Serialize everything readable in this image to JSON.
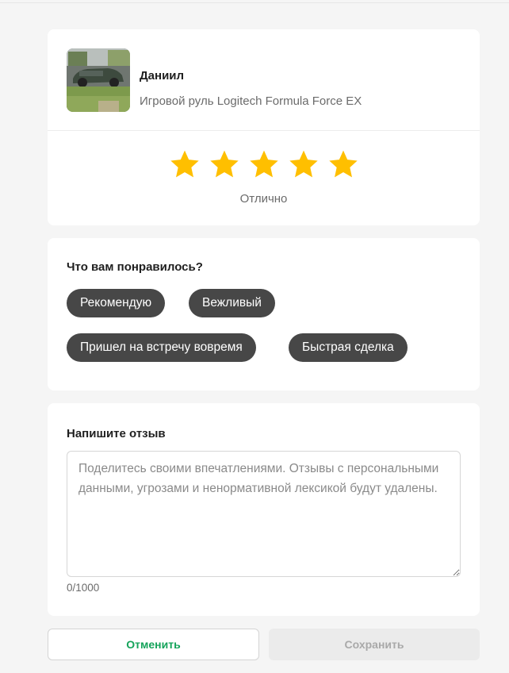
{
  "seller": {
    "name": "Даниил",
    "item_title": "Игровой руль Logitech Formula Force EX"
  },
  "rating": {
    "value": 5,
    "max": 5,
    "label": "Отлично",
    "star_color": "#ffbf00"
  },
  "likes": {
    "title": "Что вам понравилось?",
    "tags": [
      "Рекомендую",
      "Вежливый",
      "Пришел на встречу вовремя",
      "Быстрая сделка"
    ]
  },
  "review": {
    "title": "Напишите отзыв",
    "placeholder": "Поделитесь своими впечатлениями. Отзывы с персональными данными, угрозами и ненормативной лексикой будут удалены.",
    "value": "",
    "counter": "0/1000"
  },
  "actions": {
    "cancel_label": "Отменить",
    "save_label": "Сохранить",
    "accent_color": "#14a35a"
  }
}
